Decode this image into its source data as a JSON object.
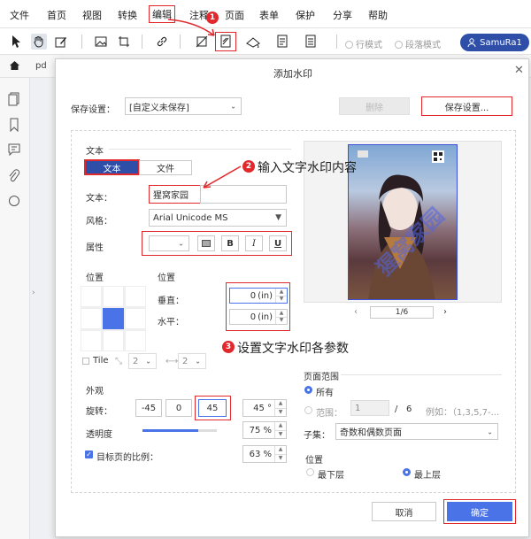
{
  "menu": [
    "文件",
    "首页",
    "视图",
    "转换",
    "编辑",
    "注释",
    "页面",
    "表单",
    "保护",
    "分享",
    "帮助"
  ],
  "toolbar": {
    "line_mode": "行模式",
    "paragraph_mode": "段落模式",
    "user": "SamuRa1"
  },
  "tab": {
    "label": "pd"
  },
  "dialog": {
    "title": "添加水印",
    "save_settings_label": "保存设置：",
    "preset_value": "[自定义未保存]",
    "delete_button": "删除",
    "save_settings_button": "保存设置...",
    "text_section": "文本",
    "tab_text": "文本",
    "tab_file": "文件",
    "text_label": "文本：",
    "text_value": "猩窝家园",
    "style_label": "风格：",
    "font_value": "Arial Unicode MS",
    "attr_label": "属性",
    "bold": "B",
    "italic": "I",
    "underline": "U",
    "position_label": "位置",
    "position_label_2": "位置",
    "vertical_label": "垂直：",
    "vertical_value": "0",
    "vertical_unit": "(in)",
    "horizontal_label": "水平：",
    "horizontal_value": "0",
    "horizontal_unit": "(in)",
    "tile_label": "Tile",
    "tile_cols": "2",
    "tile_rows": "2",
    "appearance_label": "外观",
    "rotation_label": "旋转：",
    "rotation_opts": [
      "-45",
      "0",
      "45"
    ],
    "rotation_value": "45 °",
    "opacity_label": "透明度",
    "opacity_value": "75 %",
    "opacity_fraction": 0.75,
    "scale_label": "目标页的比例：",
    "scale_value": "63 %",
    "page_nav": "1/6",
    "page_range_label": "页面范围",
    "all_label": "所有",
    "range_label": "范围：",
    "range_from": "1",
    "range_sep": "/",
    "range_total": "6",
    "range_example": "例如：（1,3,5,7-...",
    "subset_label": "子集：",
    "subset_value": "奇数和偶数页面",
    "layer_label": "位置",
    "bottom_layer": "最下层",
    "top_layer": "最上层",
    "cancel_button": "取消",
    "ok_button": "确定"
  },
  "annotations": {
    "step1": "1",
    "step2": "2",
    "step2_text": "输入文字水印内容",
    "step3": "3",
    "step3_text": "设置文字水印各参数"
  },
  "colors": {
    "accent": "#2e4ea8",
    "annotation": "#e0282d",
    "ok": "#4a73e8"
  }
}
